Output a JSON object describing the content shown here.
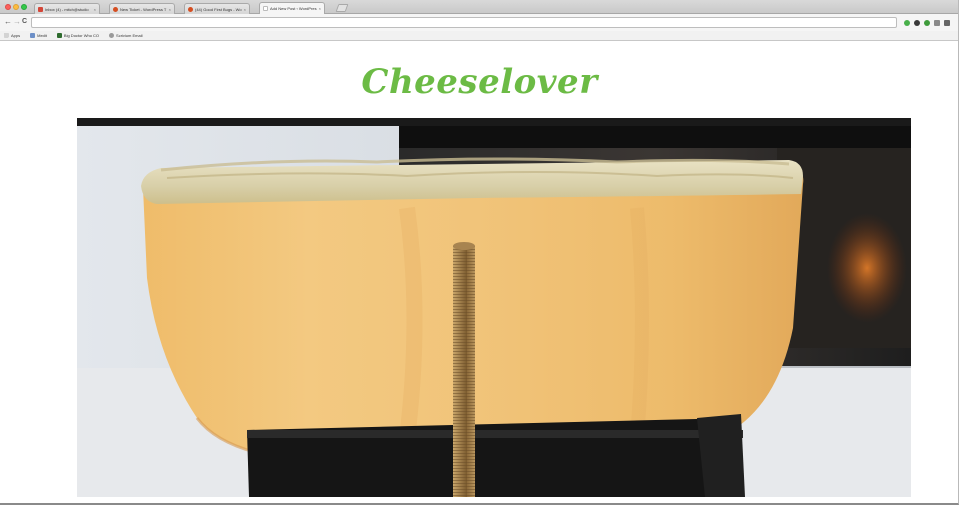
{
  "browser": {
    "tabs": [
      {
        "label": "Inbox (4) - mitch@studio",
        "favicon": "gmail-icon",
        "color": "#d44638"
      },
      {
        "label": "New Ticket - WordPress T",
        "favicon": "wordpress-icon",
        "color": "#d54e21"
      },
      {
        "label": "(44) Good First Bugs - Wo",
        "favicon": "wordpress-icon",
        "color": "#d54e21"
      },
      {
        "label": "Add New Post ‹ WordPres",
        "favicon": "wordpress-icon",
        "color": "#bbbbbb"
      }
    ],
    "close_glyph": "×",
    "nav": {
      "back": "←",
      "forward": "→",
      "reload": "C"
    },
    "bookmarks": [
      {
        "label": "Apps",
        "icon": "apps-grid-icon",
        "color": "#7a7a7a"
      },
      {
        "label": "Medit",
        "icon": "folder-icon",
        "color": "#6c8fc7"
      },
      {
        "label": "Big Doctor Who CO",
        "icon": "bookmark-icon",
        "color": "#2e6b2e"
      },
      {
        "label": "Scrivium Email",
        "icon": "bookmark-icon",
        "color": "#999999"
      }
    ],
    "extensions": [
      {
        "icon": "extension-green-icon",
        "color": "#48b04a"
      },
      {
        "icon": "extension-dark-icon",
        "color": "#3a3a3a"
      },
      {
        "icon": "extension-green2-icon",
        "color": "#3f9c3c"
      },
      {
        "icon": "extension-gray-icon",
        "color": "#8a8a8a"
      },
      {
        "icon": "extension-gray2-icon",
        "color": "#666666"
      }
    ]
  },
  "site": {
    "title": "Cheeselover",
    "title_color": "#6cbb45"
  },
  "hero": {
    "subject": "raclette-cheese-wheel-image"
  }
}
